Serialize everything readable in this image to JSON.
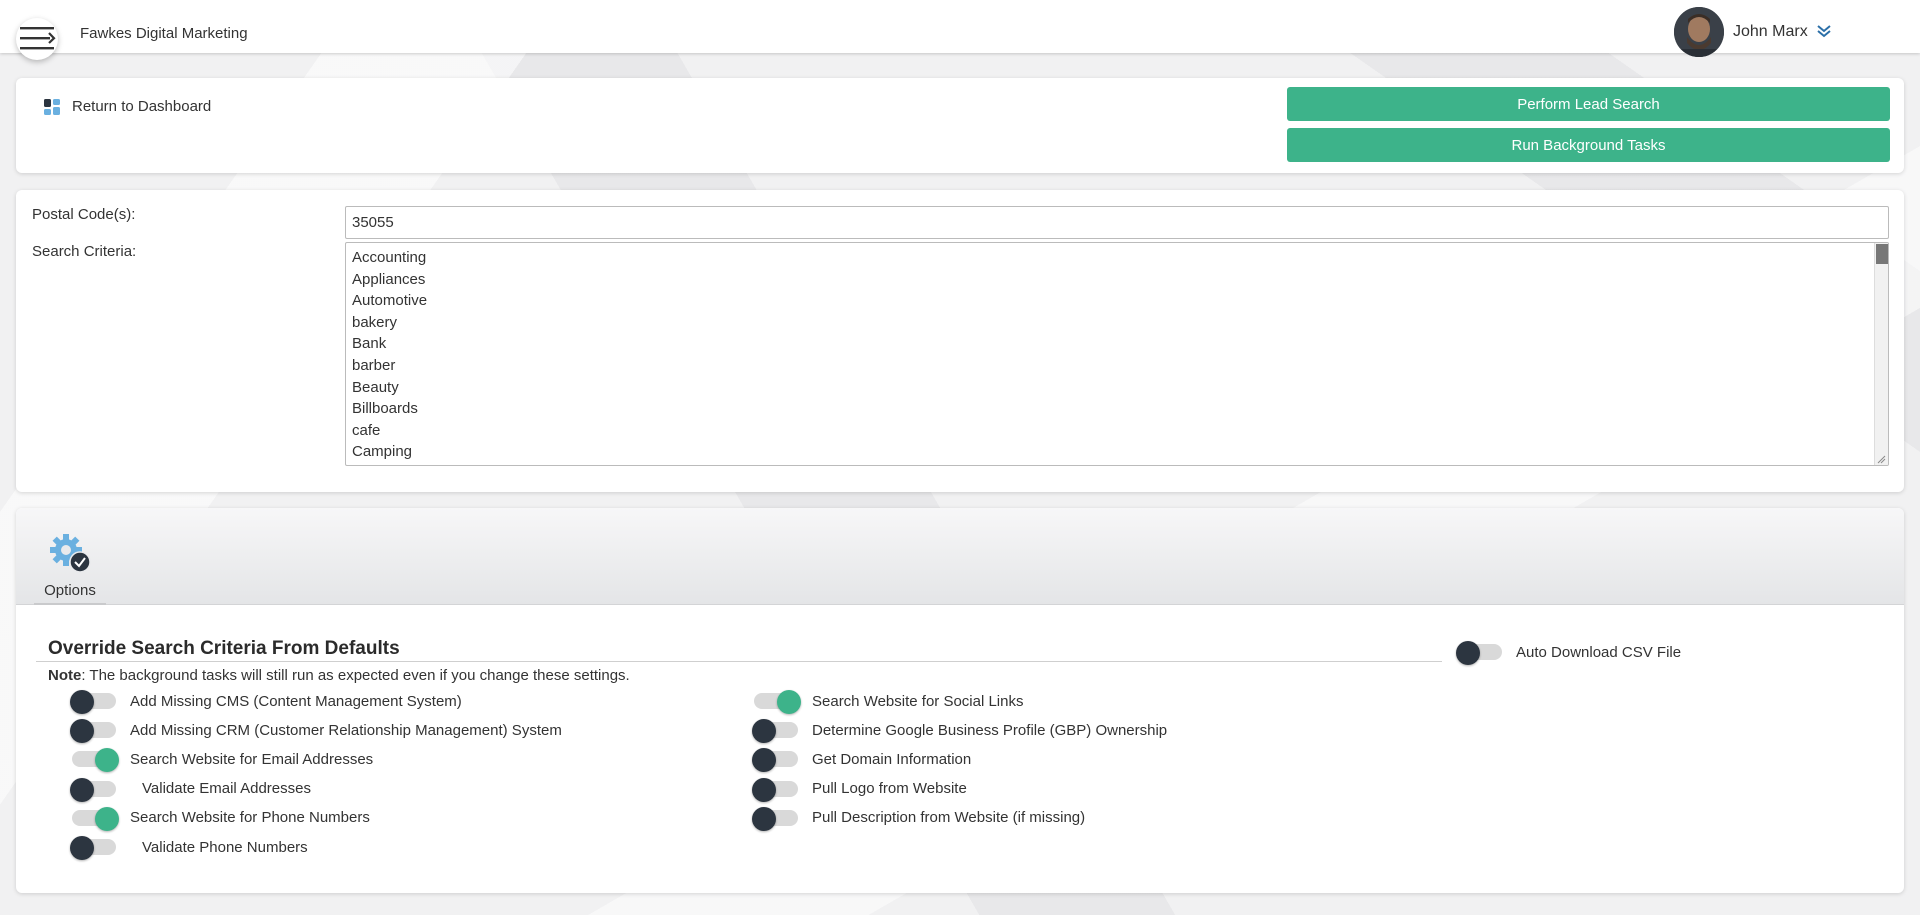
{
  "header": {
    "brand": "Fawkes Digital Marketing",
    "user_name": "John Marx",
    "menu_icon": "hamburger-icon",
    "user_menu_icon": "chevron-down-icon"
  },
  "toolbar": {
    "return_label": "Return to Dashboard",
    "return_icon": "dashboard-grid-icon",
    "perform_lead_search": "Perform Lead Search",
    "run_background_tasks": "Run Background Tasks"
  },
  "search": {
    "postal_label": "Postal Code(s):",
    "postal_value": "35055",
    "criteria_label": "Search Criteria:",
    "criteria_options": [
      "Accounting",
      "Appliances",
      "Automotive",
      "bakery",
      "Bank",
      "barber",
      "Beauty",
      "Billboards",
      "cafe",
      "Camping"
    ]
  },
  "options": {
    "tab_label": "Options",
    "tab_icon": "gear-check-icon",
    "section_title": "Override Search Criteria From Defaults",
    "note_prefix": "Note",
    "note_text": ": The background tasks will still run as expected even if you change these settings.",
    "left_column": [
      {
        "label": "Add Missing CMS (Content Management System)",
        "on": false,
        "indent": false
      },
      {
        "label": "Add Missing CRM (Customer Relationship Management) System",
        "on": false,
        "indent": false
      },
      {
        "label": "Search Website for Email Addresses",
        "on": true,
        "indent": false
      },
      {
        "label": "Validate Email Addresses",
        "on": false,
        "indent": true
      },
      {
        "label": "Search Website for Phone Numbers",
        "on": true,
        "indent": false
      },
      {
        "label": "Validate Phone Numbers",
        "on": false,
        "indent": true
      }
    ],
    "right_column": [
      {
        "label": "Search Website for Social Links",
        "on": true
      },
      {
        "label": "Determine Google Business Profile (GBP) Ownership",
        "on": false
      },
      {
        "label": "Get Domain Information",
        "on": false
      },
      {
        "label": "Pull Logo from Website",
        "on": false
      },
      {
        "label": "Pull Description from Website (if missing)",
        "on": false
      }
    ],
    "auto_download": {
      "label": "Auto Download CSV File",
      "on": false
    }
  },
  "colors": {
    "accent": "#3db38a",
    "knob_off": "#2c3540",
    "track": "#d9d9d9"
  }
}
